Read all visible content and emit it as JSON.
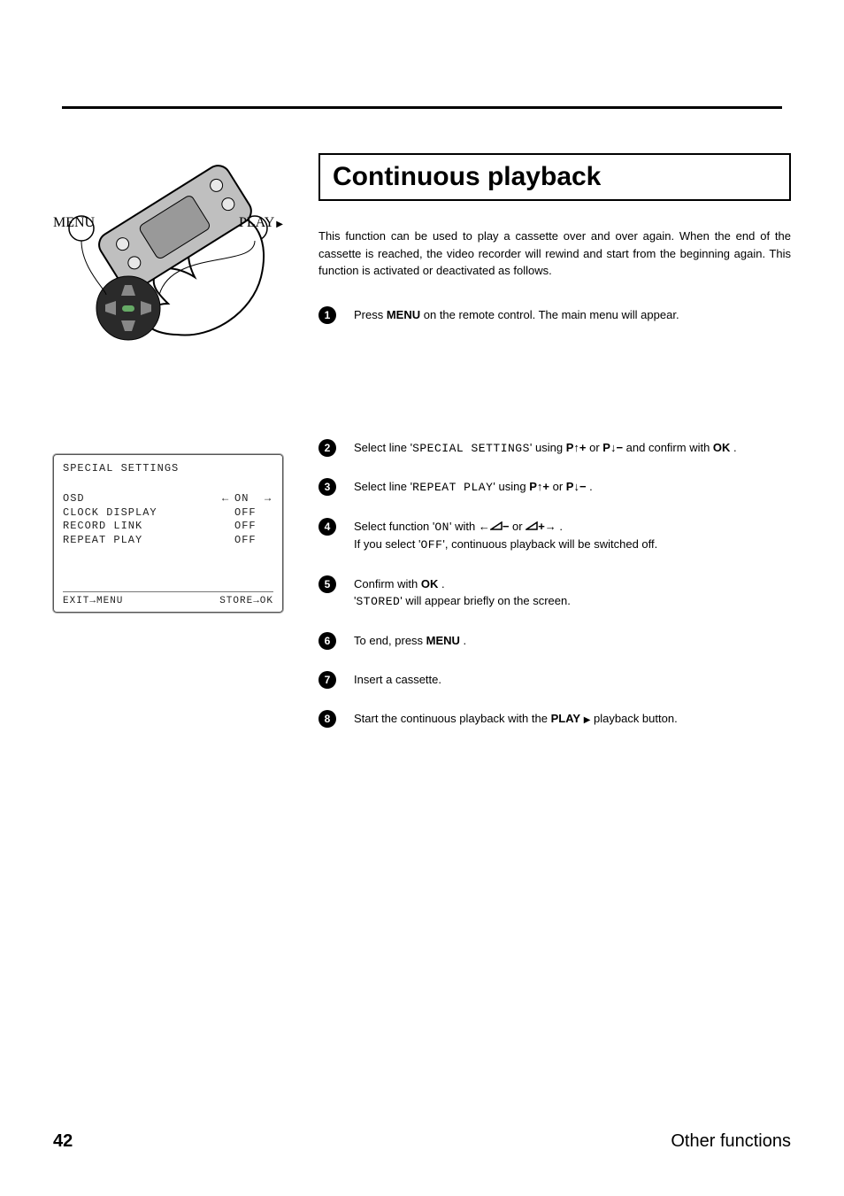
{
  "title": "Continuous playback",
  "intro": "This function can be used to play a cassette over and over again. When the end of the cassette is reached, the video recorder will rewind and start from the beginning again. This function is activated or deactivated as follows.",
  "remote": {
    "menu_label": "MENU",
    "play_label": "PLAY"
  },
  "steps": [
    {
      "n": "1",
      "pre": "Press ",
      "btn": "MENU",
      "post": " on the remote control. The main menu will appear."
    },
    {
      "n": "2",
      "pre": "Select line '",
      "osd": "SPECIAL SETTINGS",
      "mid": "' using ",
      "k1a": "P",
      "k1b_arrow": "up",
      "k1c": "plus",
      "or": " or ",
      "k2a": "P",
      "k2b_arrow": "down",
      "k2c": "minus",
      "post": " and confirm with ",
      "btn": "OK",
      "tail": " ."
    },
    {
      "n": "3",
      "pre": "Select line '",
      "osd": "REPEAT PLAY",
      "mid": "' using ",
      "k1a": "P",
      "k1b_arrow": "up",
      "k1c": "plus",
      "or": " or ",
      "k2a": "P",
      "k2b_arrow": "down",
      "k2c": "minus",
      "tail": " ."
    },
    {
      "n": "4",
      "pre": "Select function '",
      "osd": "ON",
      "mid": "' with ",
      "lra": "left-minus",
      "or": " or ",
      "lrb": "plus-right",
      "tail": " .",
      "line2a": "If you select '",
      "line2osd": "OFF",
      "line2b": "', continuous playback will be switched off."
    },
    {
      "n": "5",
      "pre": "Confirm with ",
      "btn": "OK",
      "mid": " .",
      "line2a": "'",
      "line2osd": "STORED",
      "line2b": "' will appear briefly on the screen."
    },
    {
      "n": "6",
      "pre": "To end, press ",
      "btn": "MENU",
      "tail": " ."
    },
    {
      "n": "7",
      "pre": "Insert a cassette."
    },
    {
      "n": "8",
      "pre": "Start the continuous playback with the ",
      "btn": "PLAY",
      "post": " playback button."
    }
  ],
  "osd_panel": {
    "header": "SPECIAL SETTINGS",
    "rows": [
      {
        "label": "OSD",
        "value": "ON",
        "sel": true
      },
      {
        "label": "CLOCK DISPLAY",
        "value": "OFF"
      },
      {
        "label": "RECORD LINK",
        "value": "OFF"
      },
      {
        "label": "REPEAT PLAY",
        "value": "OFF"
      }
    ],
    "footer_left": "EXIT→MENU",
    "footer_right": "STORE→OK"
  },
  "footer": {
    "page": "42",
    "section": "Other functions"
  }
}
